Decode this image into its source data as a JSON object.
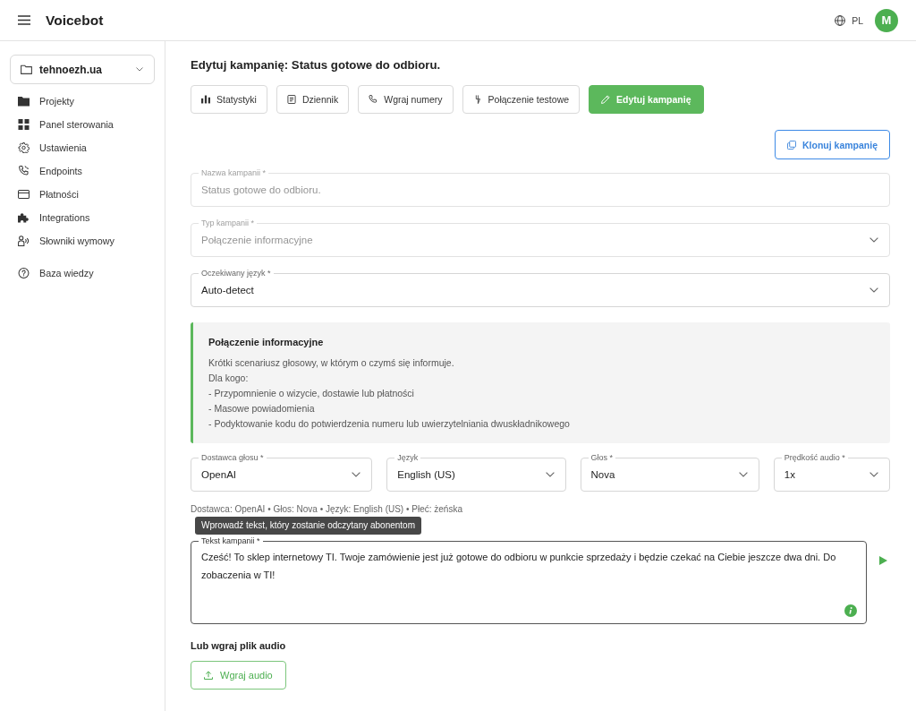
{
  "app_bar": {
    "title": "Voicebot",
    "language": "PL",
    "avatar_initial": "M"
  },
  "sidebar": {
    "project": "tehnoezh.ua",
    "groups": [
      {
        "items": [
          {
            "label": "Projekty"
          },
          {
            "label": "Panel sterowania"
          },
          {
            "label": "Ustawienia"
          },
          {
            "label": "Endpoints"
          },
          {
            "label": "Płatności"
          },
          {
            "label": "Integrations"
          },
          {
            "label": "Słowniki wymowy"
          }
        ]
      },
      {
        "items": [
          {
            "label": "Baza wiedzy"
          }
        ]
      }
    ]
  },
  "page": {
    "title": "Edytuj kampanię: Status gotowe do odbioru."
  },
  "toolbar": [
    {
      "label": "Statystyki",
      "selected": false
    },
    {
      "label": "Dziennik",
      "selected": false
    },
    {
      "label": "Wgraj numery",
      "selected": false
    },
    {
      "label": "Połączenie testowe",
      "selected": false
    },
    {
      "label": "Edytuj kampanię",
      "selected": true
    }
  ],
  "clone_button": {
    "label": "Klonuj kampanię"
  },
  "fields": [
    {
      "kind": "text",
      "label": "Nazwa kampanii *",
      "value": "Status gotowe do odbioru.",
      "disabled": true
    },
    {
      "kind": "select",
      "label": "Typ kampanii *",
      "value": "Połączenie informacyjne",
      "disabled": true
    },
    {
      "kind": "select",
      "label": "Oczekiwany język *",
      "value": "Auto-detect",
      "disabled": false
    }
  ],
  "info_box": {
    "title": "Połączenie informacyjne",
    "lines": [
      "Krótki scenariusz głosowy, w którym o czymś się informuje.",
      "Dla kogo:",
      "- Przypomnienie o wizycie, dostawie lub płatności",
      "- Masowe powiadomienia",
      "- Podyktowanie kodu do potwierdzenia numeru lub uwierzytelniania dwuskładnikowego"
    ]
  },
  "voice_settings": [
    {
      "label": "Dostawca głosu *",
      "value": "OpenAI"
    },
    {
      "label": "Język",
      "value": "English (US)"
    },
    {
      "label": "Głos *",
      "value": "Nova"
    },
    {
      "label": "Prędkość audio *",
      "value": "1x"
    }
  ],
  "voice_summary": "Dostawca: OpenAI • Głos: Nova • Język: English (US) • Płeć: żeńska",
  "campaign_text": {
    "label": "Tekst kampanii *",
    "value": "Cześć! To sklep internetowy TI. Twoje zamówienie jest już gotowe do odbioru w punkcie sprzedaży i będzie czekać na Ciebie jeszcze dwa dni. Do zobaczenia w TI!",
    "focused": true,
    "tooltip": "Wprowadź tekst, który zostanie odczytany abonentom"
  },
  "audio_upload": {
    "heading": "Lub wgraj plik audio",
    "button": "Wgraj audio"
  }
}
